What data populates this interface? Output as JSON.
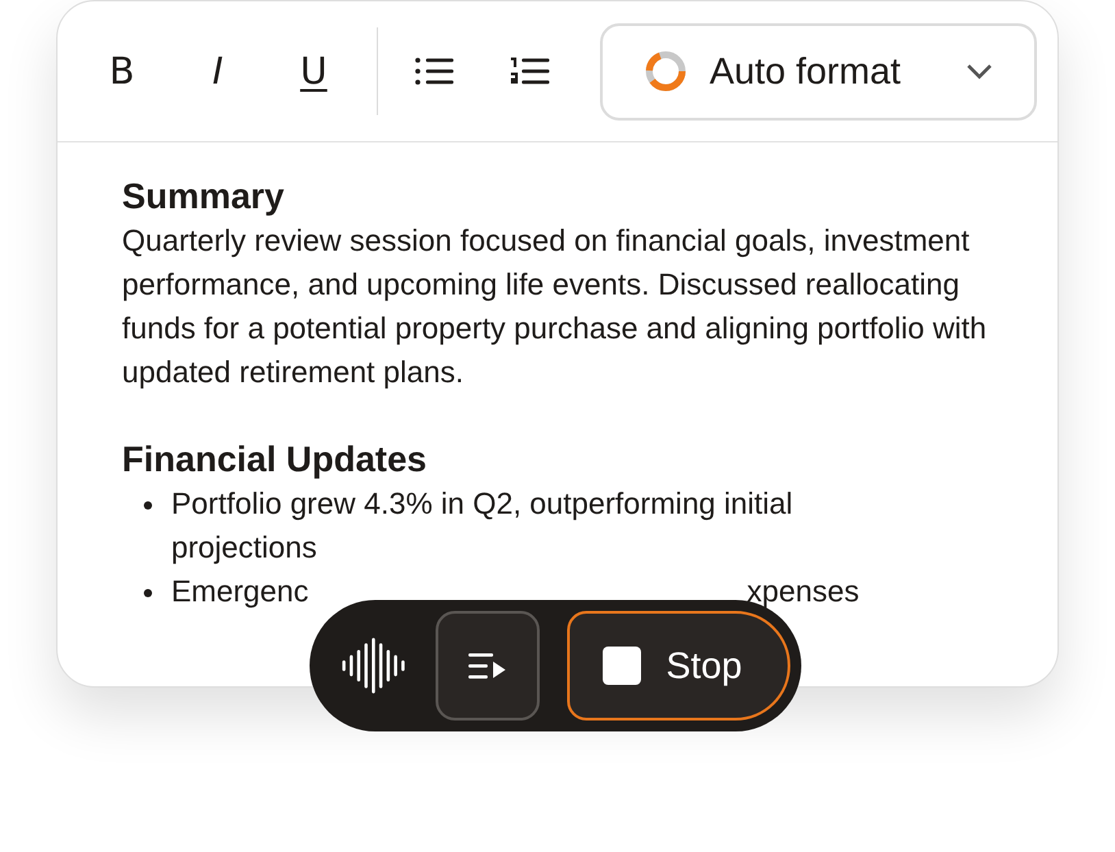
{
  "toolbar": {
    "buttons": [
      {
        "kind": "bold",
        "label": "B"
      },
      {
        "kind": "italic",
        "label": "I"
      },
      {
        "kind": "underline",
        "label": "U"
      },
      {
        "kind": "bullets"
      },
      {
        "kind": "numbers"
      }
    ],
    "format_dropdown": {
      "label": "Auto format"
    }
  },
  "document": {
    "sections": [
      {
        "heading": "Summary",
        "paragraph": "Quarterly review session focused on financial goals, investment performance, and upcoming life events. Discussed reallocating funds for a potential property purchase and aligning portfolio with updated retirement plans."
      },
      {
        "heading": "Financial Updates",
        "bullets": [
          {
            "text": "Portfolio grew 4.3% in Q2, outperforming initial projections"
          },
          {
            "text": "Emergenc",
            "text_after": "xpenses"
          }
        ]
      }
    ]
  },
  "recorder": {
    "stop_label": "Stop"
  }
}
